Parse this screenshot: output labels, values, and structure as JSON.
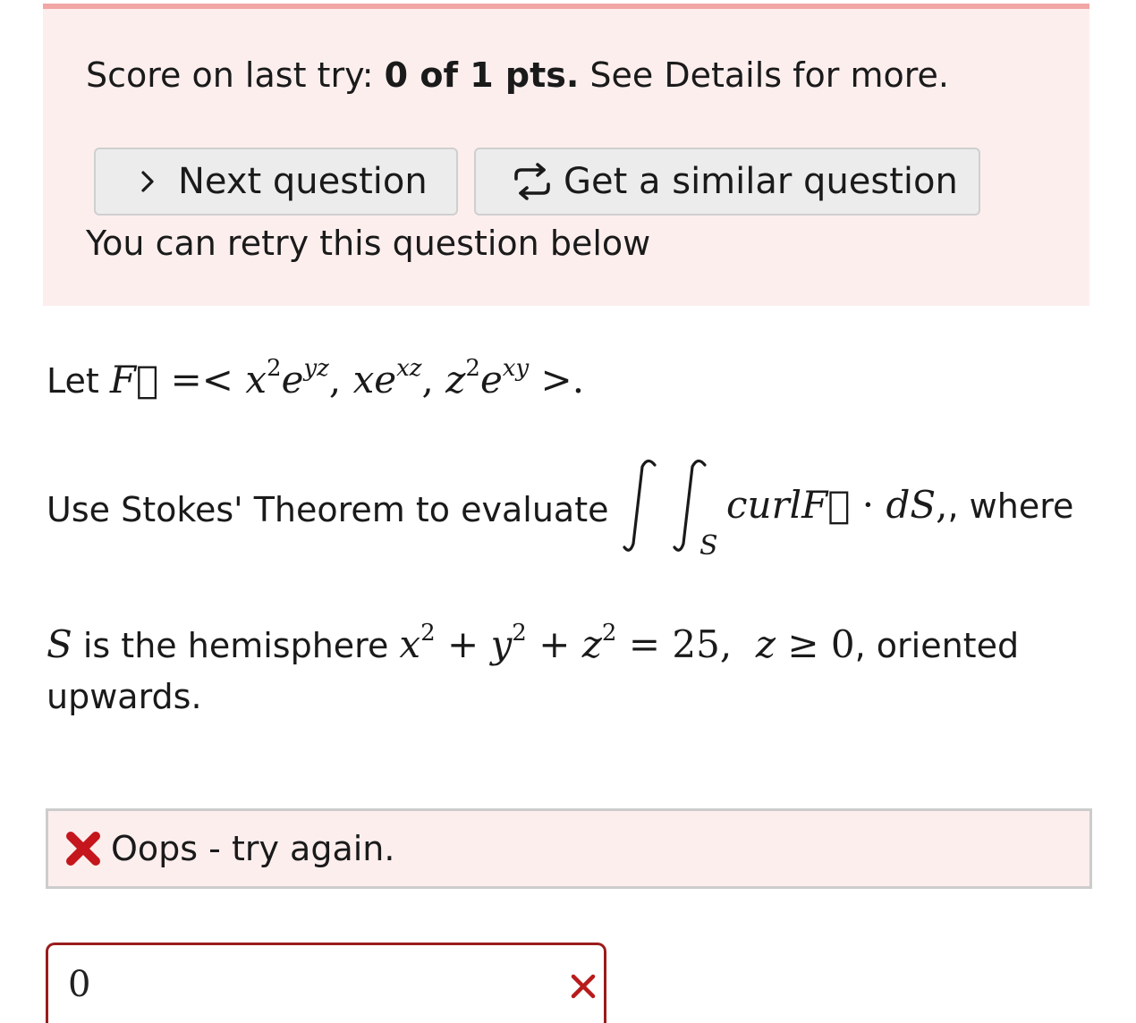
{
  "score": {
    "prefix": "Score on last try: ",
    "value": "0 of 1 pts.",
    "suffix": " See Details for more.",
    "retry_note": "You can retry this question below"
  },
  "buttons": {
    "next_label": "Next question",
    "similar_label": "Get a similar question"
  },
  "question": {
    "let": "Let ",
    "use_stokes": "Use Stokes' Theorem to evaluate ",
    "where": ", where",
    "is_the_hemisphere": " is the hemisphere ",
    "oriented": ", oriented",
    "upwards": "upwards."
  },
  "feedback": {
    "message": "Oops - try again."
  },
  "answer": {
    "value": "0"
  },
  "colors": {
    "panel_bg": "#fdeeee",
    "panel_border": "#f2a6a6",
    "error": "#c4161c",
    "answer_border": "#9b1c1c"
  },
  "icons": {
    "next": "chevron-right-icon",
    "similar": "repeat-icon",
    "error": "cross-icon",
    "clear": "x-icon"
  }
}
